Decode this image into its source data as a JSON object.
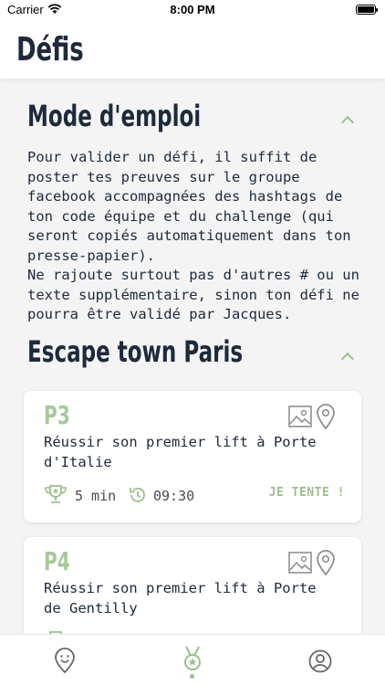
{
  "status_bar": {
    "carrier": "Carrier",
    "time": "8:00 PM"
  },
  "header": {
    "title": "Défis"
  },
  "instructions_section": {
    "title": "Mode d'emploi",
    "text": "Pour valider un défi, il suffit de poster tes preuves sur le groupe facebook accompagnées des hashtags de ton code équipe et du challenge (qui seront copiés automatiquement dans ton presse-papier).\nNe rajoute surtout pas d'autres # ou un texte supplémentaire, sinon ton défi ne pourra être validé par Jacques."
  },
  "challenge_section": {
    "title": "Escape town Paris",
    "challenges": [
      {
        "code": "P3",
        "description": "Réussir son premier lift à Porte d'Italie",
        "duration": "5 min",
        "start_time": "09:30",
        "action_label": "JE TENTE !"
      },
      {
        "code": "P4",
        "description": "Réussir son premier lift à Porte de Gentilly",
        "duration": "",
        "start_time": "",
        "action_label": ""
      }
    ]
  },
  "tab_bar": {
    "tabs": [
      {
        "icon": "face-pin-icon",
        "active": false
      },
      {
        "icon": "medal-icon",
        "active": true
      },
      {
        "icon": "profile-icon",
        "active": false
      }
    ]
  },
  "colors": {
    "accent_green": "#9bbf8e",
    "text_dark": "#1e2a3b",
    "background": "#f4f4f4"
  }
}
